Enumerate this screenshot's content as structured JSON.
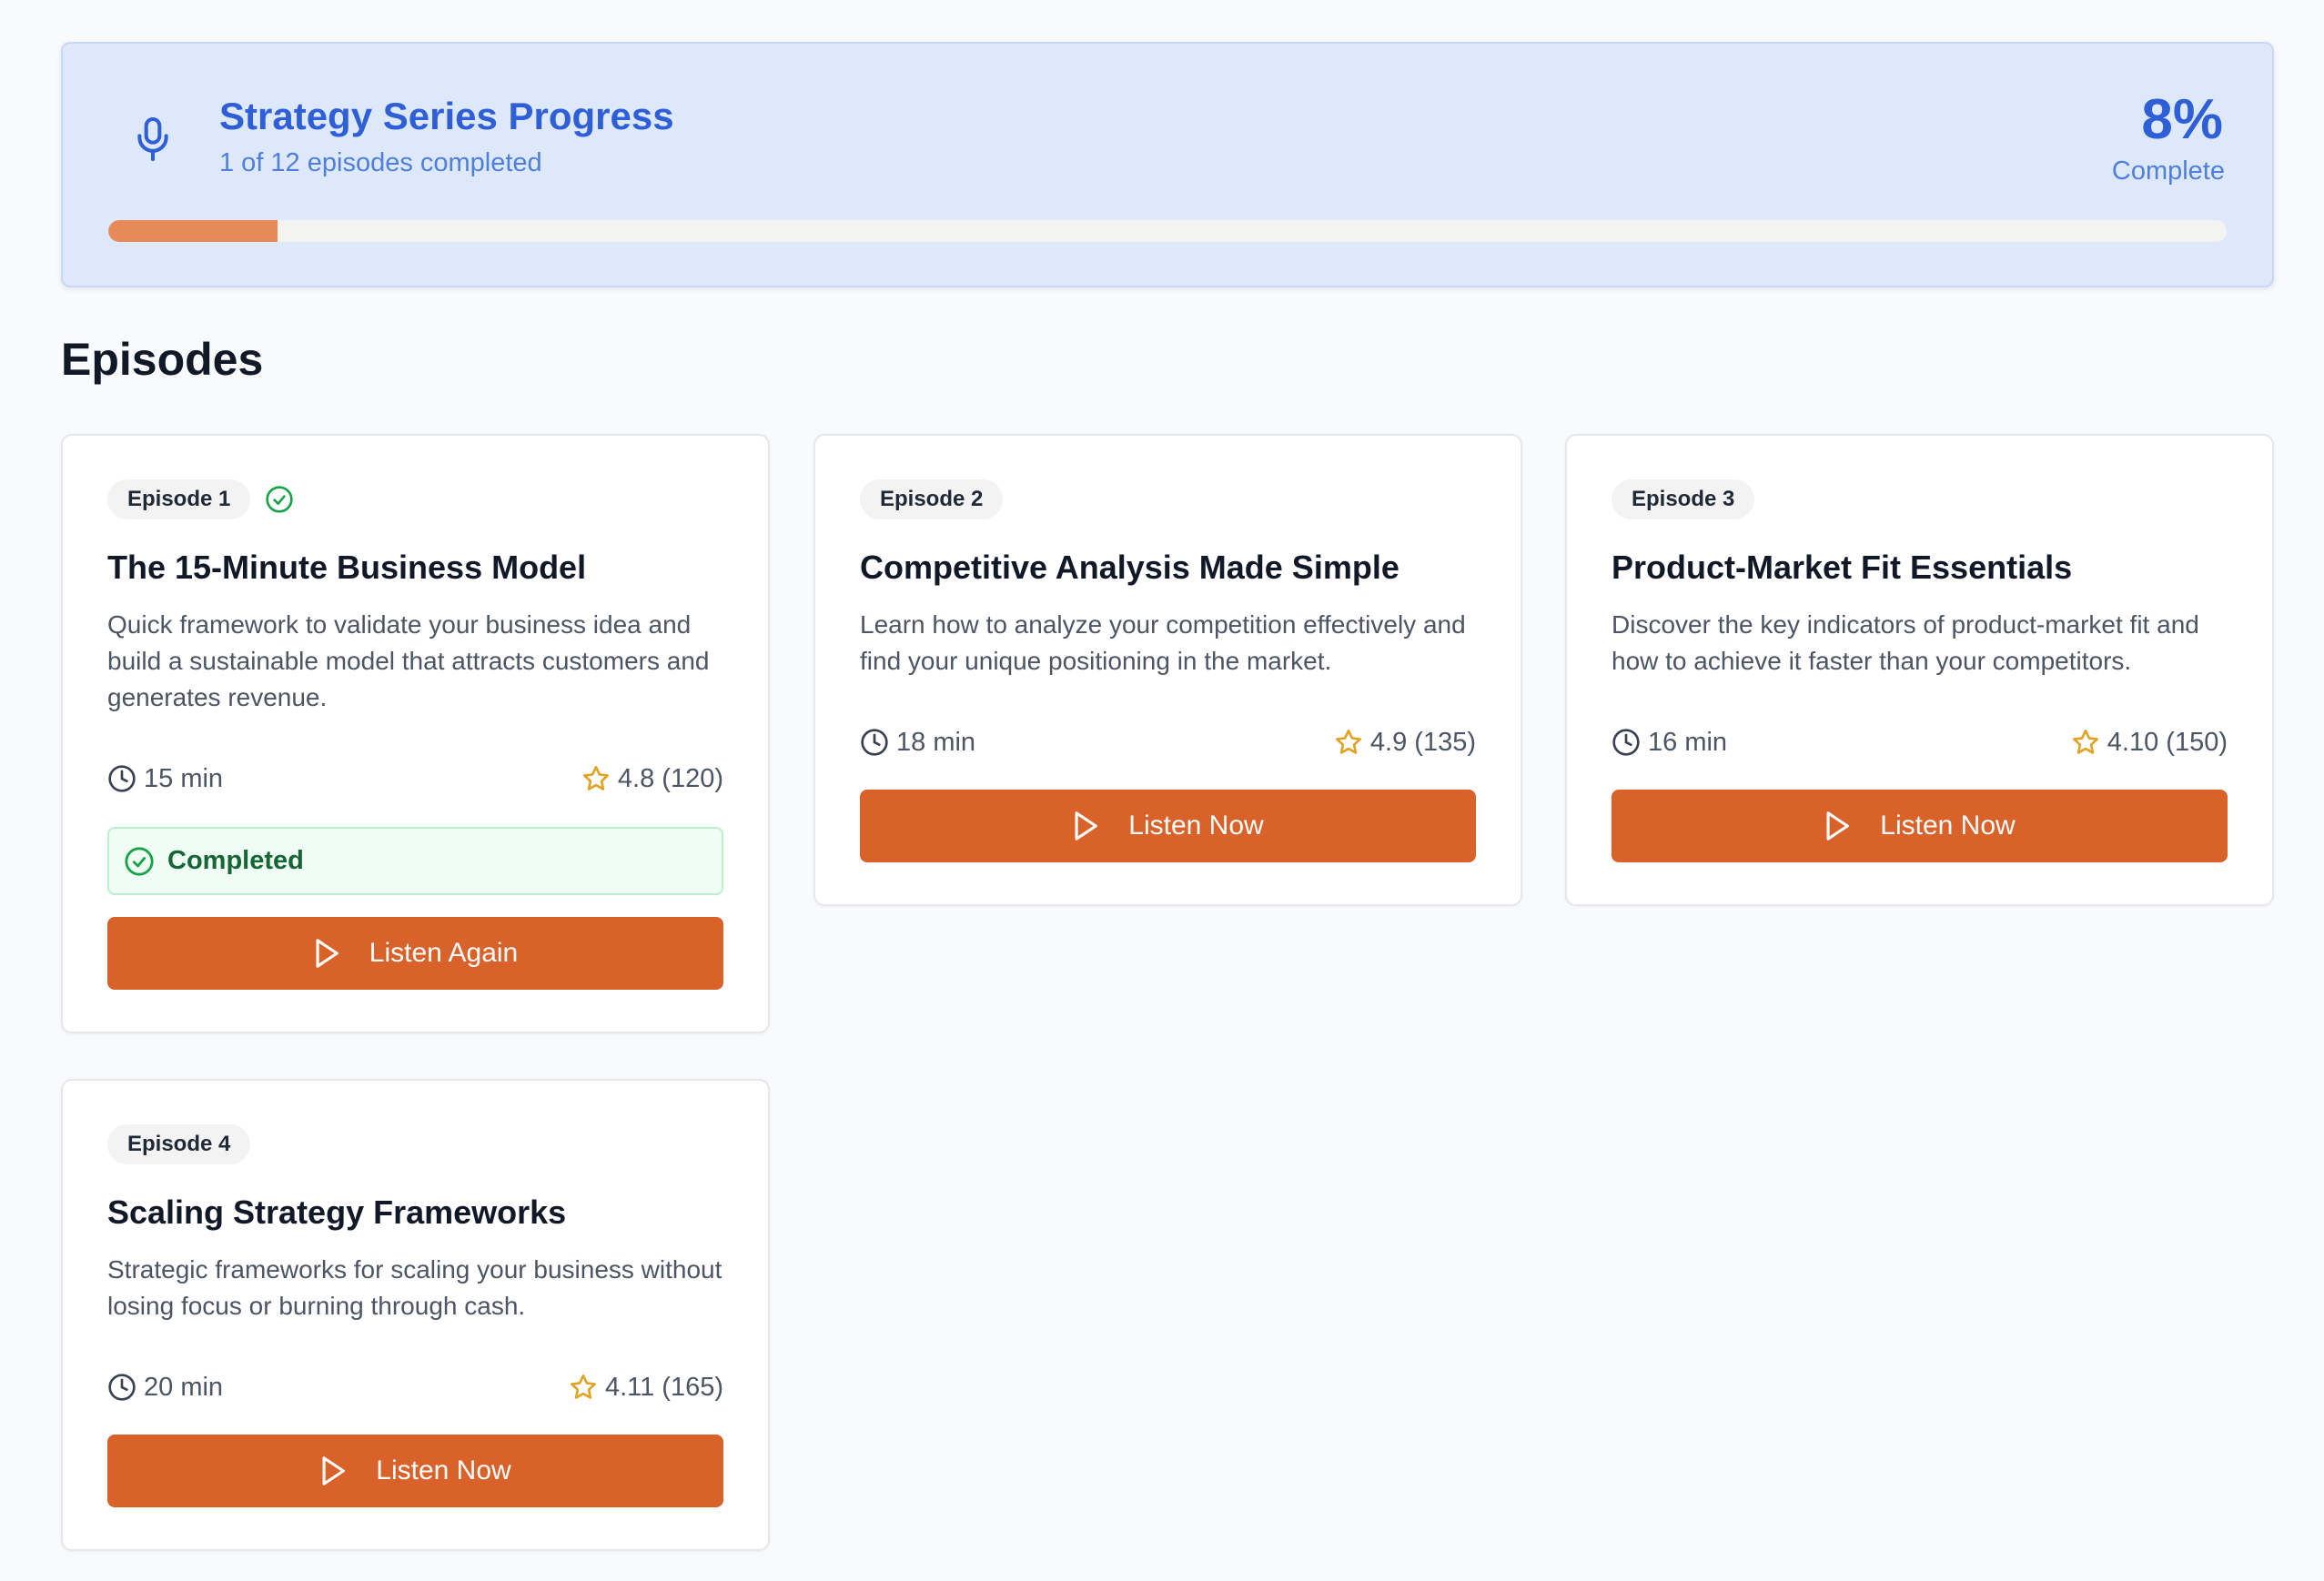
{
  "progress": {
    "title": "Strategy Series Progress",
    "subtitle": "1 of 12 episodes completed",
    "percent": "8%",
    "percent_label": "Complete",
    "fraction": 0.08,
    "icon": "microphone-icon"
  },
  "section_title": "Episodes",
  "colors": {
    "accent": "#d9622b",
    "progress_fill": "#e8895a",
    "progress_text": "#2f5fd6",
    "banner_bg": "#dde8fa",
    "success": "#16a34a",
    "star": "#e0a323"
  },
  "episodes": [
    {
      "badge": "Episode 1",
      "completed_icon": "check-circle-icon",
      "title": "The 15-Minute Business Model",
      "description": "Quick framework to validate your business idea and build a sustainable model that attracts customers and generates revenue.",
      "duration": "15 min",
      "rating": "4.8 (120)",
      "status": "Completed",
      "button": "Listen Again"
    },
    {
      "badge": "Episode 2",
      "title": "Competitive Analysis Made Simple",
      "description": "Learn how to analyze your competition effectively and find your unique positioning in the market.",
      "duration": "18 min",
      "rating": "4.9 (135)",
      "button": "Listen Now"
    },
    {
      "badge": "Episode 3",
      "title": "Product-Market Fit Essentials",
      "description": "Discover the key indicators of product-market fit and how to achieve it faster than your competitors.",
      "duration": "16 min",
      "rating": "4.10 (150)",
      "button": "Listen Now"
    },
    {
      "badge": "Episode 4",
      "title": "Scaling Strategy Frameworks",
      "description": "Strategic frameworks for scaling your business without losing focus or burning through cash.",
      "duration": "20 min",
      "rating": "4.11 (165)",
      "button": "Listen Now"
    }
  ]
}
